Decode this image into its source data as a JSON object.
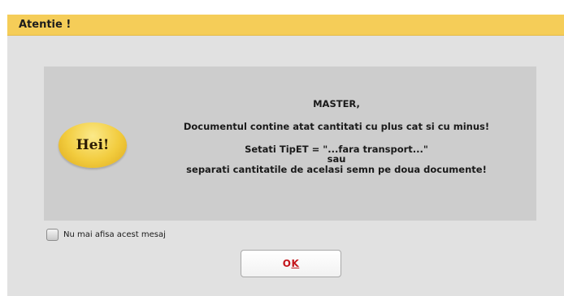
{
  "dialog": {
    "title": "Atentie !"
  },
  "badge": {
    "text": "Hei!"
  },
  "message": {
    "line1": "MASTER,",
    "line2": "Documentul contine atat cantitati cu plus cat si cu minus!",
    "line3": "Setati TipET = \"...fara transport...\"",
    "line4": "sau",
    "line5": "separati cantitatile de acelasi semn pe doua documente!"
  },
  "checkbox": {
    "label": "Nu mai afisa acest mesaj",
    "checked": false
  },
  "buttons": {
    "ok_first": "O",
    "ok_rest": "K"
  },
  "colors": {
    "titlebar": "#f5cd58",
    "ok_text": "#c4161c"
  }
}
